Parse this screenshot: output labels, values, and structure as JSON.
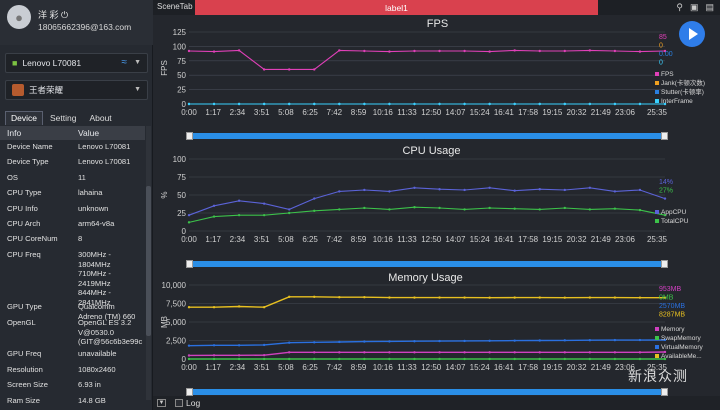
{
  "user": {
    "name": "洋 彩 ⏻",
    "email": "18065662396@163.com"
  },
  "device_select": {
    "label": "Lenovo L70081"
  },
  "game_select": {
    "label": "王者荣耀"
  },
  "tabs": [
    "Device",
    "Setting",
    "About"
  ],
  "table": {
    "headers": [
      "Info",
      "Value"
    ],
    "rows": [
      [
        "Device Name",
        "Lenovo L70081"
      ],
      [
        "Device Type",
        "Lenovo L70081"
      ],
      [
        "OS",
        "11"
      ],
      [
        "CPU Type",
        "lahaina"
      ],
      [
        "CPU Info",
        "unknown"
      ],
      [
        "CPU Arch",
        "arm64-v8a"
      ],
      [
        "CPU CoreNum",
        "8"
      ],
      [
        "CPU Freq",
        "300MHz -\n1804MHz\n710MHz -\n2419MHz\n844MHz -\n2841MHz"
      ],
      [
        "GPU Type",
        "Qualcomm\nAdreno (TM) 660"
      ],
      [
        "OpenGL",
        "OpenGL ES 3.2\nV@0530.0\n(GIT@56c6b3e99c"
      ],
      [
        "GPU Freq",
        "unavailable"
      ],
      [
        "Resolution",
        "1080x2460"
      ],
      [
        "Screen Size",
        "6.93 in"
      ],
      [
        "Ram Size",
        "14.8 GB"
      ]
    ]
  },
  "topbar": {
    "scene_tab": "SceneTab",
    "label": "label1"
  },
  "bottom": {
    "log": "Log"
  },
  "watermark": "新浪众测",
  "x_ticks": [
    "0:00",
    "1:17",
    "2:34",
    "3:51",
    "5:08",
    "6:25",
    "7:42",
    "8:59",
    "10:16",
    "11:33",
    "12:50",
    "14:07",
    "15:24",
    "16:41",
    "17:58",
    "19:15",
    "20:32",
    "21:49",
    "23:06",
    "25:35"
  ],
  "colors": {
    "fps": "#e040b8",
    "jank": "#f0a020",
    "stutter": "#2a7fe0",
    "interframe": "#39d0ff",
    "app_cpu": "#5b63d8",
    "total_cpu": "#3cc24a",
    "memory": "#d040c0",
    "swap": "#3cc24a",
    "virtual": "#2a70e0",
    "available": "#e8c020"
  },
  "chart_data": [
    {
      "type": "line",
      "title": "FPS",
      "ylabel": "FPS",
      "ylim": [
        0,
        125
      ],
      "yticks": [
        0,
        25,
        50,
        75,
        100,
        125
      ],
      "series": [
        {
          "name": "FPS",
          "values": [
            92,
            91,
            93,
            60,
            60,
            60,
            93,
            92,
            91,
            92,
            92,
            92,
            91,
            93,
            92,
            92,
            93,
            92,
            91,
            92
          ]
        },
        {
          "name": "Jank(卡顿次数)",
          "values": [
            0,
            0,
            0,
            0,
            0,
            0,
            0,
            0,
            0,
            0,
            0,
            0,
            0,
            0,
            0,
            0,
            0,
            0,
            0,
            0
          ]
        },
        {
          "name": "Stutter(卡顿率)",
          "values": [
            0,
            0,
            0,
            0,
            0,
            0,
            0,
            0,
            0,
            0,
            0,
            0,
            0,
            0,
            0,
            0,
            0,
            0,
            0,
            0
          ]
        },
        {
          "name": "InterFrame",
          "values": [
            0,
            0,
            0,
            0,
            0,
            0,
            0,
            0,
            0,
            0,
            0,
            0,
            0,
            0,
            0,
            0,
            0,
            0,
            0,
            0
          ]
        }
      ],
      "current_values": [
        "85",
        "0",
        "0.00",
        "0"
      ]
    },
    {
      "type": "line",
      "title": "CPU Usage",
      "ylabel": "%",
      "ylim": [
        0,
        100
      ],
      "yticks": [
        0,
        25,
        50,
        75,
        100
      ],
      "series": [
        {
          "name": "AppCPU",
          "values": [
            22,
            35,
            42,
            38,
            30,
            45,
            55,
            57,
            55,
            60,
            58,
            57,
            60,
            56,
            58,
            57,
            60,
            55,
            57,
            45
          ]
        },
        {
          "name": "TotalCPU",
          "values": [
            12,
            20,
            22,
            22,
            25,
            28,
            30,
            32,
            30,
            33,
            32,
            30,
            32,
            31,
            30,
            32,
            30,
            31,
            29,
            22
          ]
        }
      ],
      "current_values": [
        "14%",
        "27%"
      ]
    },
    {
      "type": "line",
      "title": "Memory Usage",
      "ylabel": "MB",
      "ylim": [
        0,
        10000
      ],
      "yticks": [
        0,
        2500,
        5000,
        7500,
        10000
      ],
      "series": [
        {
          "name": "Memory",
          "values": [
            480,
            500,
            500,
            520,
            900,
            900,
            900,
            900,
            900,
            900,
            900,
            900,
            900,
            900,
            900,
            900,
            900,
            900,
            900,
            950
          ]
        },
        {
          "name": "SwapMemory",
          "values": [
            0,
            0,
            0,
            0,
            0,
            0,
            0,
            0,
            0,
            0,
            0,
            0,
            0,
            0,
            0,
            0,
            0,
            0,
            0,
            0
          ]
        },
        {
          "name": "VirtualMemory",
          "values": [
            1800,
            1850,
            1850,
            1900,
            2200,
            2250,
            2300,
            2350,
            2380,
            2400,
            2420,
            2440,
            2460,
            2480,
            2500,
            2520,
            2540,
            2550,
            2560,
            2570
          ]
        },
        {
          "name": "AvailableMemory",
          "values": [
            7000,
            7000,
            7100,
            7000,
            8400,
            8400,
            8350,
            8350,
            8300,
            8300,
            8300,
            8300,
            8280,
            8300,
            8300,
            8290,
            8300,
            8300,
            8290,
            8287
          ]
        }
      ],
      "current_values": [
        "953MB",
        "0MB",
        "2570MB",
        "8287MB"
      ]
    }
  ]
}
